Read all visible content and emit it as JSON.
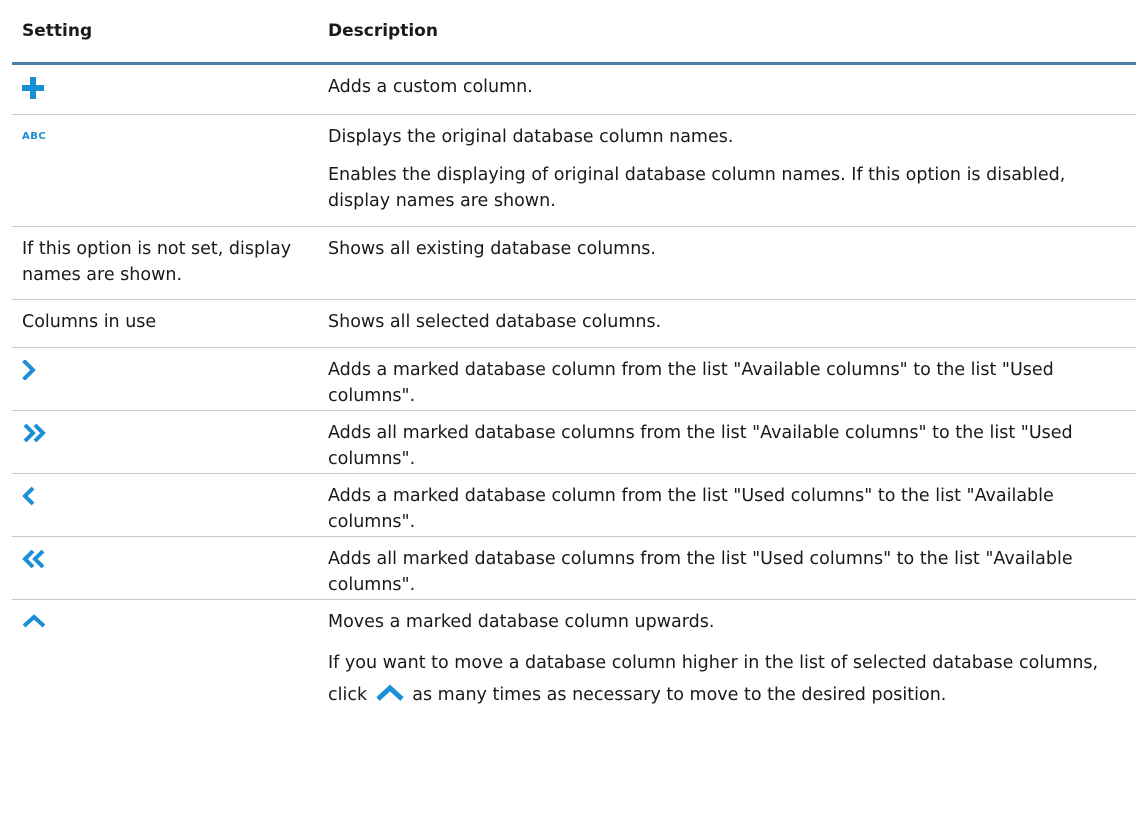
{
  "header": {
    "setting": "Setting",
    "description": "Description"
  },
  "rows": [
    {
      "setting_icon": "plus-icon",
      "description": [
        "Adds a custom column."
      ]
    },
    {
      "setting_text": "ABC",
      "setting_icon": "abc-icon",
      "description": [
        "Displays the original database column names.",
        "Enables the displaying of original database column names. If this option is disabled, display names are shown."
      ]
    },
    {
      "setting_text": "If this option is not set, display names are shown.",
      "description": [
        "Shows all existing database columns."
      ]
    },
    {
      "setting_text": "Columns in use",
      "description": [
        "Shows all selected database columns."
      ]
    },
    {
      "setting_icon": "chevron-right-icon",
      "description": [
        "Adds a marked database column from the list \"Available columns\" to the list \"Used columns\"."
      ]
    },
    {
      "setting_icon": "double-chevron-right-icon",
      "description": [
        "Adds all marked database columns from the list \"Available columns\" to the list \"Used columns\"."
      ]
    },
    {
      "setting_icon": "chevron-left-icon",
      "description": [
        "Adds a marked database column from the list \"Used columns\" to the list \"Available columns\"."
      ]
    },
    {
      "setting_icon": "double-chevron-left-icon",
      "description": [
        "Adds all marked database columns from the list \"Used columns\" to the list \"Available columns\"."
      ]
    },
    {
      "setting_icon": "chevron-up-icon",
      "description": [
        "Moves a marked database column upwards.",
        "If you want to move a database column higher in the list of selected database columns, click",
        "as many times as necessary to move to the desired position."
      ]
    }
  ],
  "colors": {
    "icon_blue": "#1b8fd6",
    "header_rule": "#4a7fa8",
    "row_rule": "#c8c8c8"
  }
}
